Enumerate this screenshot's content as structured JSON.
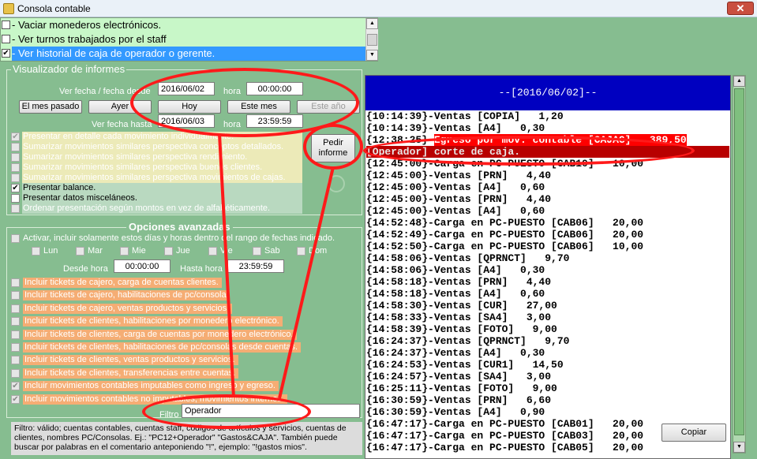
{
  "window": {
    "title": "Consola contable",
    "close": "✕"
  },
  "top_list": {
    "items": [
      {
        "label": "- Vaciar monederos electrónicos.",
        "checked": false
      },
      {
        "label": "- Ver turnos trabajados por el staff",
        "checked": false
      },
      {
        "label": "- Ver historial de caja de operador o gerente.",
        "checked": true
      }
    ]
  },
  "visualizador": {
    "title": "Visualizador de informes",
    "desde_label": "Ver fecha / fecha desde",
    "desde_date": "2016/06/02",
    "hora_label": "hora",
    "desde_time": "00:00:00",
    "hasta_label": "Ver fecha hasta",
    "hasta_date": "2016/06/03",
    "hasta_time": "23:59:59",
    "buttons": [
      "El mes pasado",
      "Ayer",
      "Hoy",
      "Este mes",
      "Este año"
    ],
    "pedir": "Pedir informe",
    "options": [
      {
        "label": "Presentar en detalle cada movimiento individualmente.",
        "checked": true,
        "enabled": false
      },
      {
        "label": "Sumarizar movimientos similares perspectiva conceptos detallados.",
        "checked": false,
        "enabled": false
      },
      {
        "label": "Sumarizar movimientos similares perspectiva rendimiento.",
        "checked": false,
        "enabled": false
      },
      {
        "label": "Sumarizar movimientos similares perspectiva buenos clientes.",
        "checked": false,
        "enabled": false
      },
      {
        "label": "Sumarizar movimientos similares perspectiva movimientos de cajas.",
        "checked": false,
        "enabled": false
      },
      {
        "label": "Presentar balance.",
        "checked": true,
        "enabled": true
      },
      {
        "label": "Presentar datos misceláneos.",
        "checked": false,
        "enabled": true
      },
      {
        "label": "Ordenar presentación según montos en vez de alfabéticamente.",
        "checked": false,
        "enabled": false
      }
    ]
  },
  "avanzadas": {
    "title": "Opciones avanzadas",
    "activar": "Activar, incluir solamente estos días y horas dentro del rango de fechas indicado.",
    "days": [
      "Lun",
      "Mar",
      "Mie",
      "Jue",
      "Vie",
      "Sab",
      "Dom"
    ],
    "desde_hora_label": "Desde hora",
    "desde_hora": "00:00:00",
    "hasta_hora_label": "Hasta hora",
    "hasta_hora": "23:59:59",
    "tickets": [
      {
        "label": "Incluir tickets de cajero, carga de cuentas clientes.",
        "checked": false
      },
      {
        "label": "Incluir tickets de cajero, habilitaciones de pc/consola",
        "checked": false
      },
      {
        "label": "Incluir tickets de cajero, ventas productos y servicios.",
        "checked": false
      },
      {
        "label": "Incluir tickets de clientes, habilitaciones por monedero electrónico.",
        "checked": false
      },
      {
        "label": "Incluir tickets de clientes, carga de cuentas por monedero electrónico.",
        "checked": false
      },
      {
        "label": "Incluir tickets de clientes, habilitaciones de pc/consolas desde cuentas.",
        "checked": false
      },
      {
        "label": "Incluir tickets de clientes, ventas productos y servicios.",
        "checked": false
      },
      {
        "label": "Incluir tickets de clientes, transferencias entre cuentas.",
        "checked": false
      },
      {
        "label": "Incluir movimientos contables imputables como ingreso y egreso.",
        "checked": true
      },
      {
        "label": "Incluir movimientos contables no imputables, movimientos internos.",
        "checked": true
      }
    ],
    "filtro_label": "Filtro",
    "filtro_value": "Operador",
    "help": "Filtro: válido; cuentas contables, cuentas staff, códigos de artículos y servicios, cuentas de clientes, nombres PC/Consolas. Ej.: \"PC12+Operador\" \"Gastos&CAJA\". También puede buscar por palabras en el comentario anteponiendo \"!\", ejemplo: \"!gastos mios\"."
  },
  "report": {
    "header": "--[2016/06/02]--",
    "copy_button": "Copiar",
    "lines": [
      {
        "text": "{10:14:39}-Ventas [COPIA]   1,20"
      },
      {
        "text": "{10:14:39}-Ventas [A4]   0,30"
      },
      {
        "pre": "{12:38:25}-",
        "hl": "Egreso por mov. contable [CAJAG]   389,50"
      },
      {
        "text": "[Operador] corte de caja.",
        "style": "dr"
      },
      {
        "text": "{12:45:00}-Carga en PC-PUESTO [CAB10]   10,00"
      },
      {
        "text": "{12:45:00}-Ventas [PRN]   4,40"
      },
      {
        "text": "{12:45:00}-Ventas [A4]   0,60"
      },
      {
        "text": "{12:45:00}-Ventas [PRN]   4,40"
      },
      {
        "text": "{12:45:00}-Ventas [A4]   0,60"
      },
      {
        "text": "{14:52:48}-Carga en PC-PUESTO [CAB06]   20,00"
      },
      {
        "text": "{14:52:49}-Carga en PC-PUESTO [CAB06]   20,00"
      },
      {
        "text": "{14:52:50}-Carga en PC-PUESTO [CAB06]   10,00"
      },
      {
        "text": "{14:58:06}-Ventas [QPRNCT]   9,70"
      },
      {
        "text": "{14:58:06}-Ventas [A4]   0,30"
      },
      {
        "text": "{14:58:18}-Ventas [PRN]   4,40"
      },
      {
        "text": "{14:58:18}-Ventas [A4]   0,60"
      },
      {
        "text": "{14:58:30}-Ventas [CUR]   27,00"
      },
      {
        "text": "{14:58:33}-Ventas [SA4]   3,00"
      },
      {
        "text": "{14:58:39}-Ventas [FOTO]   9,00"
      },
      {
        "text": "{16:24:37}-Ventas [QPRNCT]   9,70"
      },
      {
        "text": "{16:24:37}-Ventas [A4]   0,30"
      },
      {
        "text": "{16:24:53}-Ventas [CUR1]   14,50"
      },
      {
        "text": "{16:24:57}-Ventas [SA4]   3,00"
      },
      {
        "text": "{16:25:11}-Ventas [FOTO]   9,00"
      },
      {
        "text": "{16:30:59}-Ventas [PRN]   6,60"
      },
      {
        "text": "{16:30:59}-Ventas [A4]   0,90"
      },
      {
        "text": "{16:47:17}-Carga en PC-PUESTO [CAB01]   20,00"
      },
      {
        "text": "{16:47:17}-Carga en PC-PUESTO [CAB03]   20,00"
      },
      {
        "text": "{16:47:17}-Carga en PC-PUESTO [CAB05]   20,00"
      }
    ]
  }
}
